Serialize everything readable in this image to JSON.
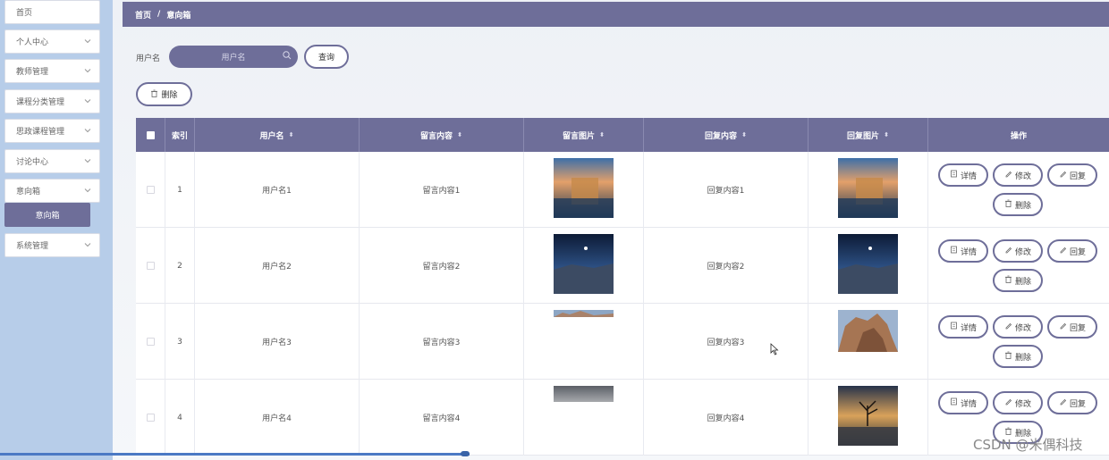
{
  "sidebar": {
    "items": [
      {
        "label": "首页",
        "chevron": false
      },
      {
        "label": "个人中心",
        "chevron": true
      },
      {
        "label": "教师管理",
        "chevron": true
      },
      {
        "label": "课程分类管理",
        "chevron": true
      },
      {
        "label": "思政课程管理",
        "chevron": true
      },
      {
        "label": "讨论中心",
        "chevron": true
      },
      {
        "label": "意向箱",
        "chevron": true
      },
      {
        "label": "意向箱",
        "sub": true,
        "active": true
      },
      {
        "label": "系统管理",
        "chevron": true
      }
    ]
  },
  "breadcrumb": {
    "home": "首页",
    "separator": "/",
    "current": "意向箱"
  },
  "search": {
    "label": "用户名",
    "placeholder": "用户名",
    "query_button": "查询"
  },
  "toolbar": {
    "delete_label": "删除"
  },
  "table": {
    "columns": [
      "索引",
      "用户名",
      "留言内容",
      "留言图片",
      "回复内容",
      "回复图片",
      "操作"
    ],
    "rows": [
      {
        "index": "1",
        "username": "用户名1",
        "message": "留言内容1",
        "reply": "回复内容1"
      },
      {
        "index": "2",
        "username": "用户名2",
        "message": "留言内容2",
        "reply": "回复内容2"
      },
      {
        "index": "3",
        "username": "用户名3",
        "message": "留言内容3",
        "reply": "回复内容3"
      },
      {
        "index": "4",
        "username": "用户名4",
        "message": "留言内容4",
        "reply": "回复内容4"
      }
    ],
    "actions": {
      "detail": "详情",
      "edit": "修改",
      "reply": "回复",
      "delete": "删除"
    }
  },
  "watermark": "CSDN @米偶科技",
  "colors": {
    "accent": "#6e6e99",
    "sidebar_bg": "#b7cde9"
  }
}
